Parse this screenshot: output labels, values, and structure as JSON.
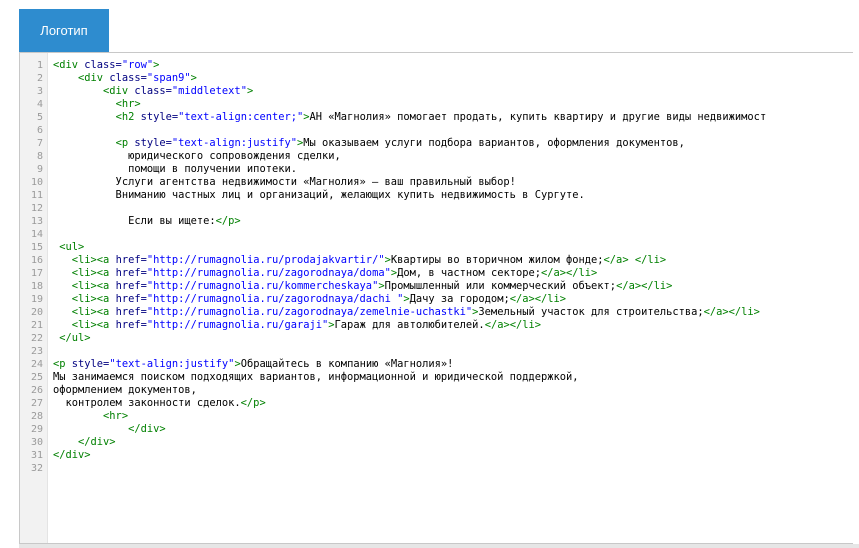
{
  "tab": {
    "label": "Логотип"
  },
  "colors": {
    "tab_bg": "#2e8ccf",
    "tag": "#008000",
    "attr": "#000080",
    "string": "#0000ff",
    "text": "#000000"
  },
  "editor": {
    "lines": [
      {
        "n": "1",
        "tokens": [
          [
            "t",
            "<div "
          ],
          [
            "a",
            "class="
          ],
          [
            "s",
            "\"row\""
          ],
          [
            "t",
            ">"
          ]
        ]
      },
      {
        "n": "2",
        "tokens": [
          [
            "x",
            "    "
          ],
          [
            "t",
            "<div "
          ],
          [
            "a",
            "class="
          ],
          [
            "s",
            "\"span9\""
          ],
          [
            "t",
            ">"
          ]
        ]
      },
      {
        "n": "3",
        "tokens": [
          [
            "x",
            "        "
          ],
          [
            "t",
            "<div "
          ],
          [
            "a",
            "class="
          ],
          [
            "s",
            "\"middletext\""
          ],
          [
            "t",
            ">"
          ]
        ]
      },
      {
        "n": "4",
        "tokens": [
          [
            "x",
            "          "
          ],
          [
            "t",
            "<hr>"
          ]
        ]
      },
      {
        "n": "5",
        "tokens": [
          [
            "x",
            "          "
          ],
          [
            "t",
            "<h2 "
          ],
          [
            "a",
            "style="
          ],
          [
            "s",
            "\"text-align:center;\""
          ],
          [
            "t",
            ">"
          ],
          [
            "x",
            "АН «Магнолия» помогает продать, купить квартиру и другие виды недвижимост"
          ]
        ]
      },
      {
        "n": "6",
        "tokens": []
      },
      {
        "n": "7",
        "tokens": [
          [
            "x",
            "          "
          ],
          [
            "t",
            "<p "
          ],
          [
            "a",
            "style="
          ],
          [
            "s",
            "\"text-align:justify\""
          ],
          [
            "t",
            ">"
          ],
          [
            "x",
            "Мы оказываем услуги подбора вариантов, оформления документов,"
          ]
        ]
      },
      {
        "n": "8",
        "tokens": [
          [
            "x",
            "            юридического сопровождения сделки,"
          ]
        ]
      },
      {
        "n": "9",
        "tokens": [
          [
            "x",
            "            помощи в получении ипотеки."
          ]
        ]
      },
      {
        "n": "10",
        "tokens": [
          [
            "x",
            "          Услуги агентства недвижимости «Магнолия» — ваш правильный выбор!"
          ]
        ]
      },
      {
        "n": "11",
        "tokens": [
          [
            "x",
            "          Вниманию частных лиц и организаций, желающих купить недвижимость в Сургуте."
          ]
        ]
      },
      {
        "n": "12",
        "tokens": []
      },
      {
        "n": "13",
        "tokens": [
          [
            "x",
            "            Если вы ищете:"
          ],
          [
            "t",
            "</p>"
          ]
        ]
      },
      {
        "n": "14",
        "tokens": []
      },
      {
        "n": "15",
        "tokens": [
          [
            "x",
            " "
          ],
          [
            "t",
            "<ul>"
          ]
        ]
      },
      {
        "n": "16",
        "tokens": [
          [
            "x",
            "   "
          ],
          [
            "t",
            "<li><a "
          ],
          [
            "a",
            "href="
          ],
          [
            "s",
            "\"http://rumagnolia.ru/prodajakvartir/\""
          ],
          [
            "t",
            ">"
          ],
          [
            "x",
            "Квартиры во вторичном жилом фонде;"
          ],
          [
            "t",
            "</a>"
          ],
          [
            "x",
            " "
          ],
          [
            "t",
            "</li>"
          ]
        ]
      },
      {
        "n": "17",
        "tokens": [
          [
            "x",
            "   "
          ],
          [
            "t",
            "<li><a "
          ],
          [
            "a",
            "href="
          ],
          [
            "s",
            "\"http://rumagnolia.ru/zagorodnaya/doma\""
          ],
          [
            "t",
            ">"
          ],
          [
            "x",
            "Дом, в частном секторе;"
          ],
          [
            "t",
            "</a></li>"
          ]
        ]
      },
      {
        "n": "18",
        "tokens": [
          [
            "x",
            "   "
          ],
          [
            "t",
            "<li><a "
          ],
          [
            "a",
            "href="
          ],
          [
            "s",
            "\"http://rumagnolia.ru/kommercheskaya\""
          ],
          [
            "t",
            ">"
          ],
          [
            "x",
            "Промышленный или коммерческий объект;"
          ],
          [
            "t",
            "</a></li>"
          ]
        ]
      },
      {
        "n": "19",
        "tokens": [
          [
            "x",
            "   "
          ],
          [
            "t",
            "<li><a "
          ],
          [
            "a",
            "href="
          ],
          [
            "s",
            "\"http://rumagnolia.ru/zagorodnaya/dachi \""
          ],
          [
            "t",
            ">"
          ],
          [
            "x",
            "Дачу за городом;"
          ],
          [
            "t",
            "</a></li>"
          ]
        ]
      },
      {
        "n": "20",
        "tokens": [
          [
            "x",
            "   "
          ],
          [
            "t",
            "<li><a "
          ],
          [
            "a",
            "href="
          ],
          [
            "s",
            "\"http://rumagnolia.ru/zagorodnaya/zemelnie-uchastki\""
          ],
          [
            "t",
            ">"
          ],
          [
            "x",
            "Земельный участок для строительства;"
          ],
          [
            "t",
            "</a></li>"
          ]
        ]
      },
      {
        "n": "21",
        "tokens": [
          [
            "x",
            "   "
          ],
          [
            "t",
            "<li><a "
          ],
          [
            "a",
            "href="
          ],
          [
            "s",
            "\"http://rumagnolia.ru/garaji\""
          ],
          [
            "t",
            ">"
          ],
          [
            "x",
            "Гараж для автолюбителей."
          ],
          [
            "t",
            "</a></li>"
          ]
        ]
      },
      {
        "n": "22",
        "tokens": [
          [
            "x",
            " "
          ],
          [
            "t",
            "</ul>"
          ]
        ]
      },
      {
        "n": "23",
        "tokens": []
      },
      {
        "n": "24",
        "tokens": [
          [
            "t",
            "<p "
          ],
          [
            "a",
            "style="
          ],
          [
            "s",
            "\"text-align:justify\""
          ],
          [
            "t",
            ">"
          ],
          [
            "x",
            "Обращайтесь в компанию «Магнолия»!"
          ]
        ]
      },
      {
        "n": "25",
        "tokens": [
          [
            "x",
            "Мы занимаемся поиском подходящих вариантов, информационной и юридической поддержкой,"
          ]
        ]
      },
      {
        "n": "26",
        "tokens": [
          [
            "x",
            "оформлением документов,"
          ]
        ]
      },
      {
        "n": "27",
        "tokens": [
          [
            "x",
            "  контролем законности сделок."
          ],
          [
            "t",
            "</p>"
          ]
        ]
      },
      {
        "n": "28",
        "tokens": [
          [
            "x",
            "        "
          ],
          [
            "t",
            "<hr>"
          ]
        ]
      },
      {
        "n": "29",
        "tokens": [
          [
            "x",
            "            "
          ],
          [
            "t",
            "</div>"
          ]
        ]
      },
      {
        "n": "30",
        "tokens": [
          [
            "x",
            "    "
          ],
          [
            "t",
            "</div>"
          ]
        ]
      },
      {
        "n": "31",
        "tokens": [
          [
            "t",
            "</div>"
          ]
        ]
      },
      {
        "n": "32",
        "tokens": []
      }
    ]
  }
}
